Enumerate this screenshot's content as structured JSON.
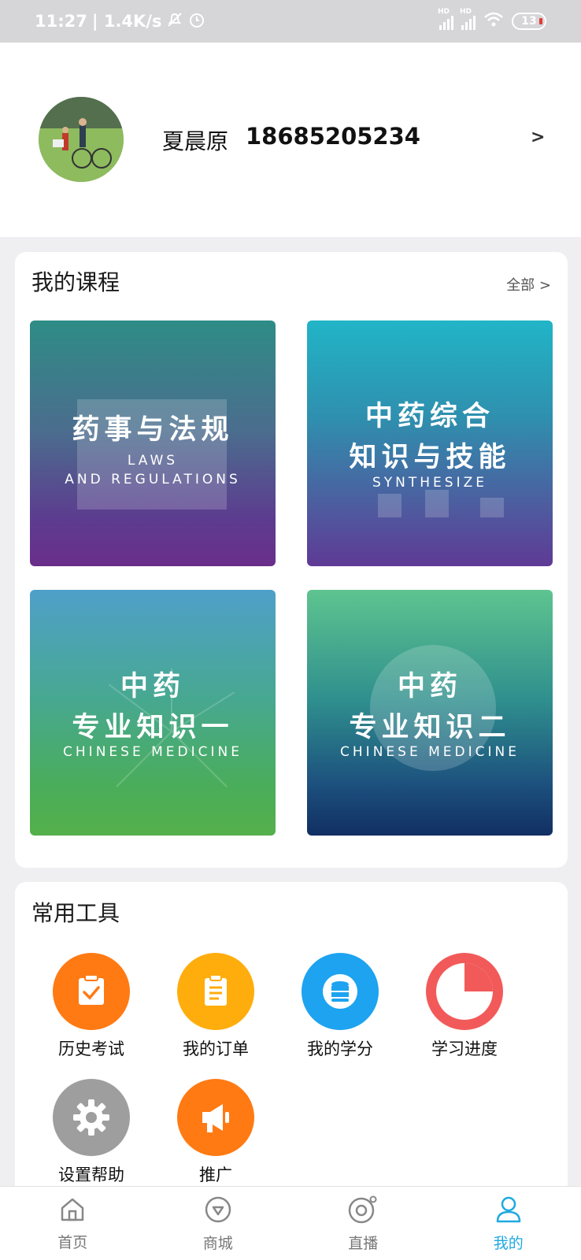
{
  "status_bar": {
    "time": "11:27",
    "net": "| 1.4K/s",
    "signal1": "HD",
    "signal2": "HD",
    "battery": "13"
  },
  "profile": {
    "name": "夏晨原",
    "phone": "18685205234",
    "arrow": ">"
  },
  "courses": {
    "title": "我的课程",
    "more": "全部 >",
    "items": [
      {
        "title_lines": [
          "药事与法规"
        ],
        "subtitle_lines": [
          "LAWS",
          "AND REGULATIONS"
        ]
      },
      {
        "title_lines": [
          "中药综合",
          "知识与技能"
        ],
        "subtitle_lines": [
          "SYNTHESIZE"
        ]
      },
      {
        "title_lines": [
          "中药",
          "专业知识一"
        ],
        "subtitle_lines": [
          "CHINESE MEDICINE"
        ]
      },
      {
        "title_lines": [
          "中药",
          "专业知识二"
        ],
        "subtitle_lines": [
          "CHINESE MEDICINE"
        ]
      }
    ]
  },
  "tools": {
    "title": "常用工具",
    "items": [
      {
        "label": "历史考试",
        "icon": "exam-history-icon",
        "color": "#ff7a13"
      },
      {
        "label": "我的订单",
        "icon": "order-icon",
        "color": "#ffad0d"
      },
      {
        "label": "我的学分",
        "icon": "credit-icon",
        "color": "#1da3f0"
      },
      {
        "label": "学习进度",
        "icon": "progress-icon",
        "color": "#f25a5a"
      },
      {
        "label": "设置帮助",
        "icon": "gear-icon",
        "color": "#9e9e9e"
      },
      {
        "label": "推广",
        "icon": "megaphone-icon",
        "color": "#ff7a13"
      }
    ]
  },
  "tabbar": {
    "items": [
      {
        "label": "首页",
        "icon": "home-icon"
      },
      {
        "label": "商城",
        "icon": "shop-icon"
      },
      {
        "label": "直播",
        "icon": "live-icon"
      },
      {
        "label": "我的",
        "icon": "profile-icon",
        "active": true
      }
    ],
    "active_color": "#1fa9e2"
  }
}
